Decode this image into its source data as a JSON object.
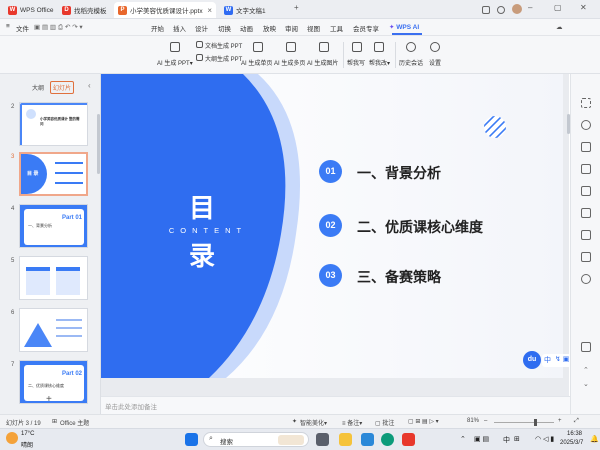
{
  "titlebar": {
    "tabs": [
      {
        "label": "WPS Office",
        "color": "#e8382c",
        "glyph": "W"
      },
      {
        "label": "找稻壳模板",
        "color": "#e8382c",
        "glyph": "D"
      },
      {
        "label": "小学美容优质课设计.pptx",
        "color": "#e8672c",
        "glyph": "P"
      },
      {
        "label": "文字文稿1",
        "color": "#2f6bf2",
        "glyph": "W"
      }
    ]
  },
  "menubar": {
    "file_label": "文件",
    "items": [
      "开始",
      "插入",
      "设计",
      "切换",
      "动画",
      "放映",
      "审阅",
      "视图",
      "工具",
      "会员专享"
    ],
    "wps_ai": "WPS AI",
    "share": "分享"
  },
  "ribbon": {
    "ai_ppt": "AI 生成 PPT",
    "doc_ppt": "文档生成 PPT",
    "outline_ppt": "大纲生成 PPT",
    "single_page": "AI 生成单页",
    "multi_page": "AI 生成多页",
    "image": "AI 生成图片",
    "help_write": "帮我写",
    "help_edit": "帮我改",
    "history": "历史会话",
    "settings": "设置"
  },
  "leftpanel": {
    "tab_outline": "大纲",
    "tab_slides": "幻灯片",
    "thumbs": [
      {
        "num": "2",
        "text": "小学美容优质课计 整的需问"
      },
      {
        "num": "3",
        "text": "目 录"
      },
      {
        "num": "4",
        "text": "一、背景分析",
        "part": "Part 01"
      },
      {
        "num": "5",
        "text": ""
      },
      {
        "num": "6",
        "text": ""
      },
      {
        "num": "7",
        "text": "二、优质课核心维度",
        "part": "Part 02"
      }
    ],
    "add": "+"
  },
  "slide": {
    "title_top": "目",
    "title_sub": "CONTENT",
    "title_bottom": "录",
    "items": [
      {
        "num": "01",
        "text": "一、背景分析"
      },
      {
        "num": "02",
        "text": "二、优质课核心维度"
      },
      {
        "num": "03",
        "text": "三、备赛策略"
      }
    ],
    "accent": "#2f6df0",
    "badge_color": "#3b7bf5"
  },
  "ime": {
    "logo": "du",
    "lang": "中"
  },
  "notes": {
    "placeholder": "单击此处添加备注"
  },
  "statusbar": {
    "slide_count": "幻灯片 3 / 19",
    "theme": "Office 主题",
    "beautify": "智能美化",
    "notes": "备注",
    "comments": "批注",
    "zoom": "81%"
  },
  "taskbar": {
    "weather_temp": "17°C",
    "weather_desc": "晴朗",
    "search": "搜索",
    "time": "16:38",
    "date": "2025/3/7",
    "lang": "中"
  }
}
